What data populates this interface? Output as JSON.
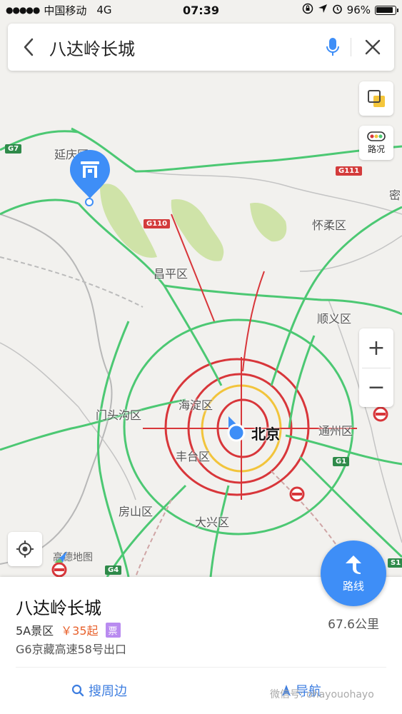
{
  "status_bar": {
    "signal": "●●●●●",
    "carrier": "中国移动",
    "network": "4G",
    "time": "07:39",
    "battery": "96%"
  },
  "search": {
    "query": "八达岭长城"
  },
  "map_controls": {
    "traffic_label": "路况",
    "zoom_in": "+",
    "zoom_out": "−",
    "route_label": "路线",
    "logo_text": "高德地图"
  },
  "map_labels": {
    "yanqing": "延庆区",
    "huairou": "怀柔区",
    "changping": "昌平区",
    "shunyi": "顺义区",
    "haidian": "海淀区",
    "beijing": "北京",
    "mentougou": "门头沟区",
    "fengtai": "丰台区",
    "tongzhou": "通州区",
    "fangshan": "房山区",
    "daxing": "大兴区",
    "mi": "密"
  },
  "road_shields": {
    "g7": "G7",
    "g111": "G111",
    "g110": "G110",
    "g1": "G1",
    "g4": "G4",
    "s1": "S1"
  },
  "poi": {
    "name": "八达岭长城",
    "category": "5A景区",
    "price": "￥35起",
    "ticket": "票",
    "address": "G6京藏高速58号出口",
    "distance": "67.6公里"
  },
  "actions": {
    "nearby": "搜周边",
    "navigate": "导航"
  },
  "watermark": "微信号: ohayouohayo",
  "colors": {
    "accent": "#3e8ef7",
    "traffic_green": "#4cc873",
    "traffic_red": "#d8363a",
    "traffic_yellow": "#f2c43b",
    "price": "#e8612c"
  }
}
